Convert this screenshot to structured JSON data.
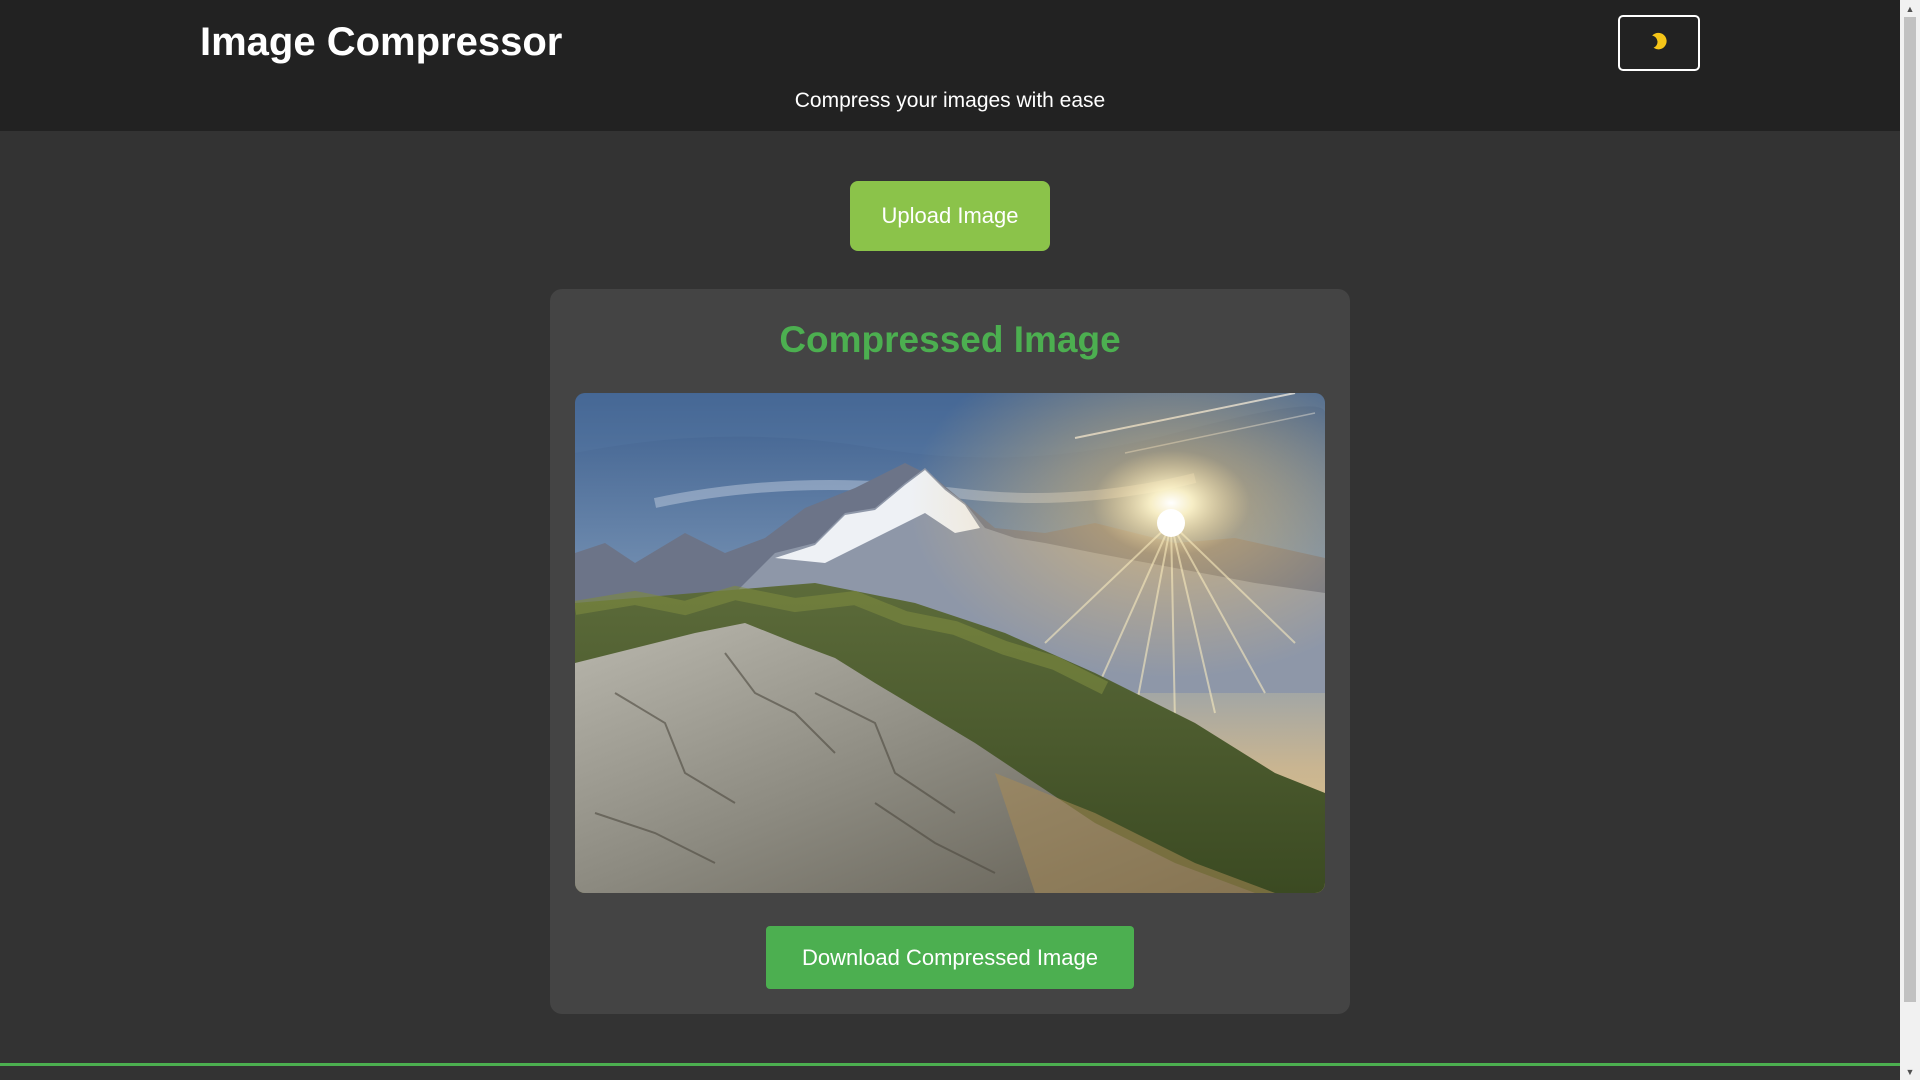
{
  "header": {
    "title": "Image Compressor",
    "subtitle": "Compress your images with ease",
    "theme_toggle_icon": "moon-icon"
  },
  "upload": {
    "label": "Upload Image"
  },
  "result": {
    "title": "Compressed Image",
    "image_alt": "mountain-sunset-photo",
    "download_label": "Download Compressed Image"
  },
  "scrollbar": {
    "up_glyph": "▲",
    "down_glyph": "▼"
  },
  "colors": {
    "accent": "#4caf50",
    "upload_button": "#8bc34a",
    "header_bg": "#222222",
    "page_bg": "#333333",
    "card_bg": "#444444",
    "moon": "#f5c518"
  }
}
